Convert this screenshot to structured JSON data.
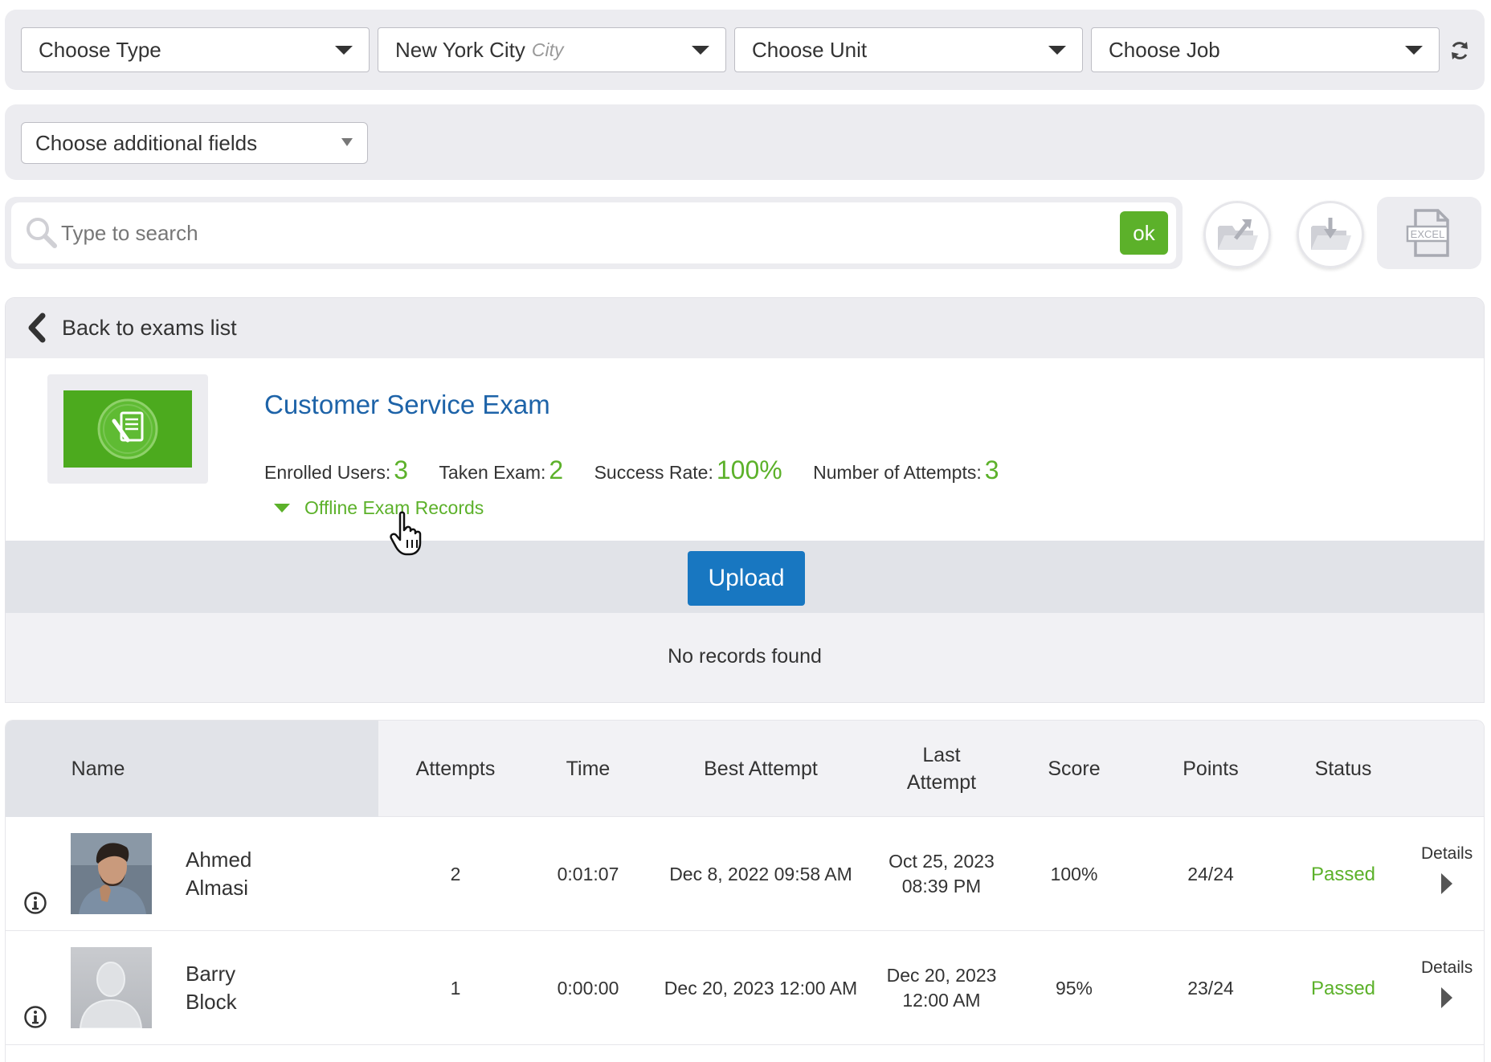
{
  "filters": {
    "type": {
      "label": "Choose Type"
    },
    "city": {
      "label": "New York City",
      "sub": "City"
    },
    "unit": {
      "label": "Choose Unit"
    },
    "job": {
      "label": "Choose Job"
    }
  },
  "additional_fields": {
    "label": "Choose additional fields"
  },
  "search": {
    "placeholder": "Type to search",
    "button_label": "ok"
  },
  "toolbar_icons": [
    "import-folder-icon",
    "export-folder-icon",
    "excel-file-icon"
  ],
  "excel_icon_text": "EXCEL",
  "back": {
    "label": "Back to exams list"
  },
  "exam": {
    "title": "Customer Service Exam",
    "stats": [
      {
        "label": "Enrolled Users:",
        "value": "3"
      },
      {
        "label": "Taken Exam:",
        "value": "2"
      },
      {
        "label": "Success Rate:",
        "value": "100%"
      },
      {
        "label": "Number of Attempts:",
        "value": "3"
      }
    ],
    "offline_label": "Offline Exam Records"
  },
  "upload": {
    "label": "Upload"
  },
  "empty_state": "No records found",
  "table": {
    "columns": [
      "Name",
      "Attempts",
      "Time",
      "Best Attempt",
      "Last Attempt",
      "Score",
      "Points",
      "Status"
    ],
    "details_label": "Details",
    "rows": [
      {
        "first": "Ahmed",
        "last": "Almasi",
        "attempts": "2",
        "time": "0:01:07",
        "best": "Dec 8, 2022 09:58 AM",
        "last_date": "Oct 25, 2023",
        "last_time": "08:39 PM",
        "score": "100%",
        "points": "24/24",
        "status": "Passed"
      },
      {
        "first": "Barry",
        "last": "Block",
        "attempts": "1",
        "time": "0:00:00",
        "best": "Dec 20, 2023 12:00 AM",
        "last_date": "Dec 20, 2023",
        "last_time": "12:00 AM",
        "score": "95%",
        "points": "23/24",
        "status": "Passed"
      }
    ]
  },
  "colors": {
    "accent_green": "#5cb12a",
    "link_blue": "#1d63a8",
    "upload_blue": "#1877c1",
    "panel_gray": "#ececf0"
  }
}
